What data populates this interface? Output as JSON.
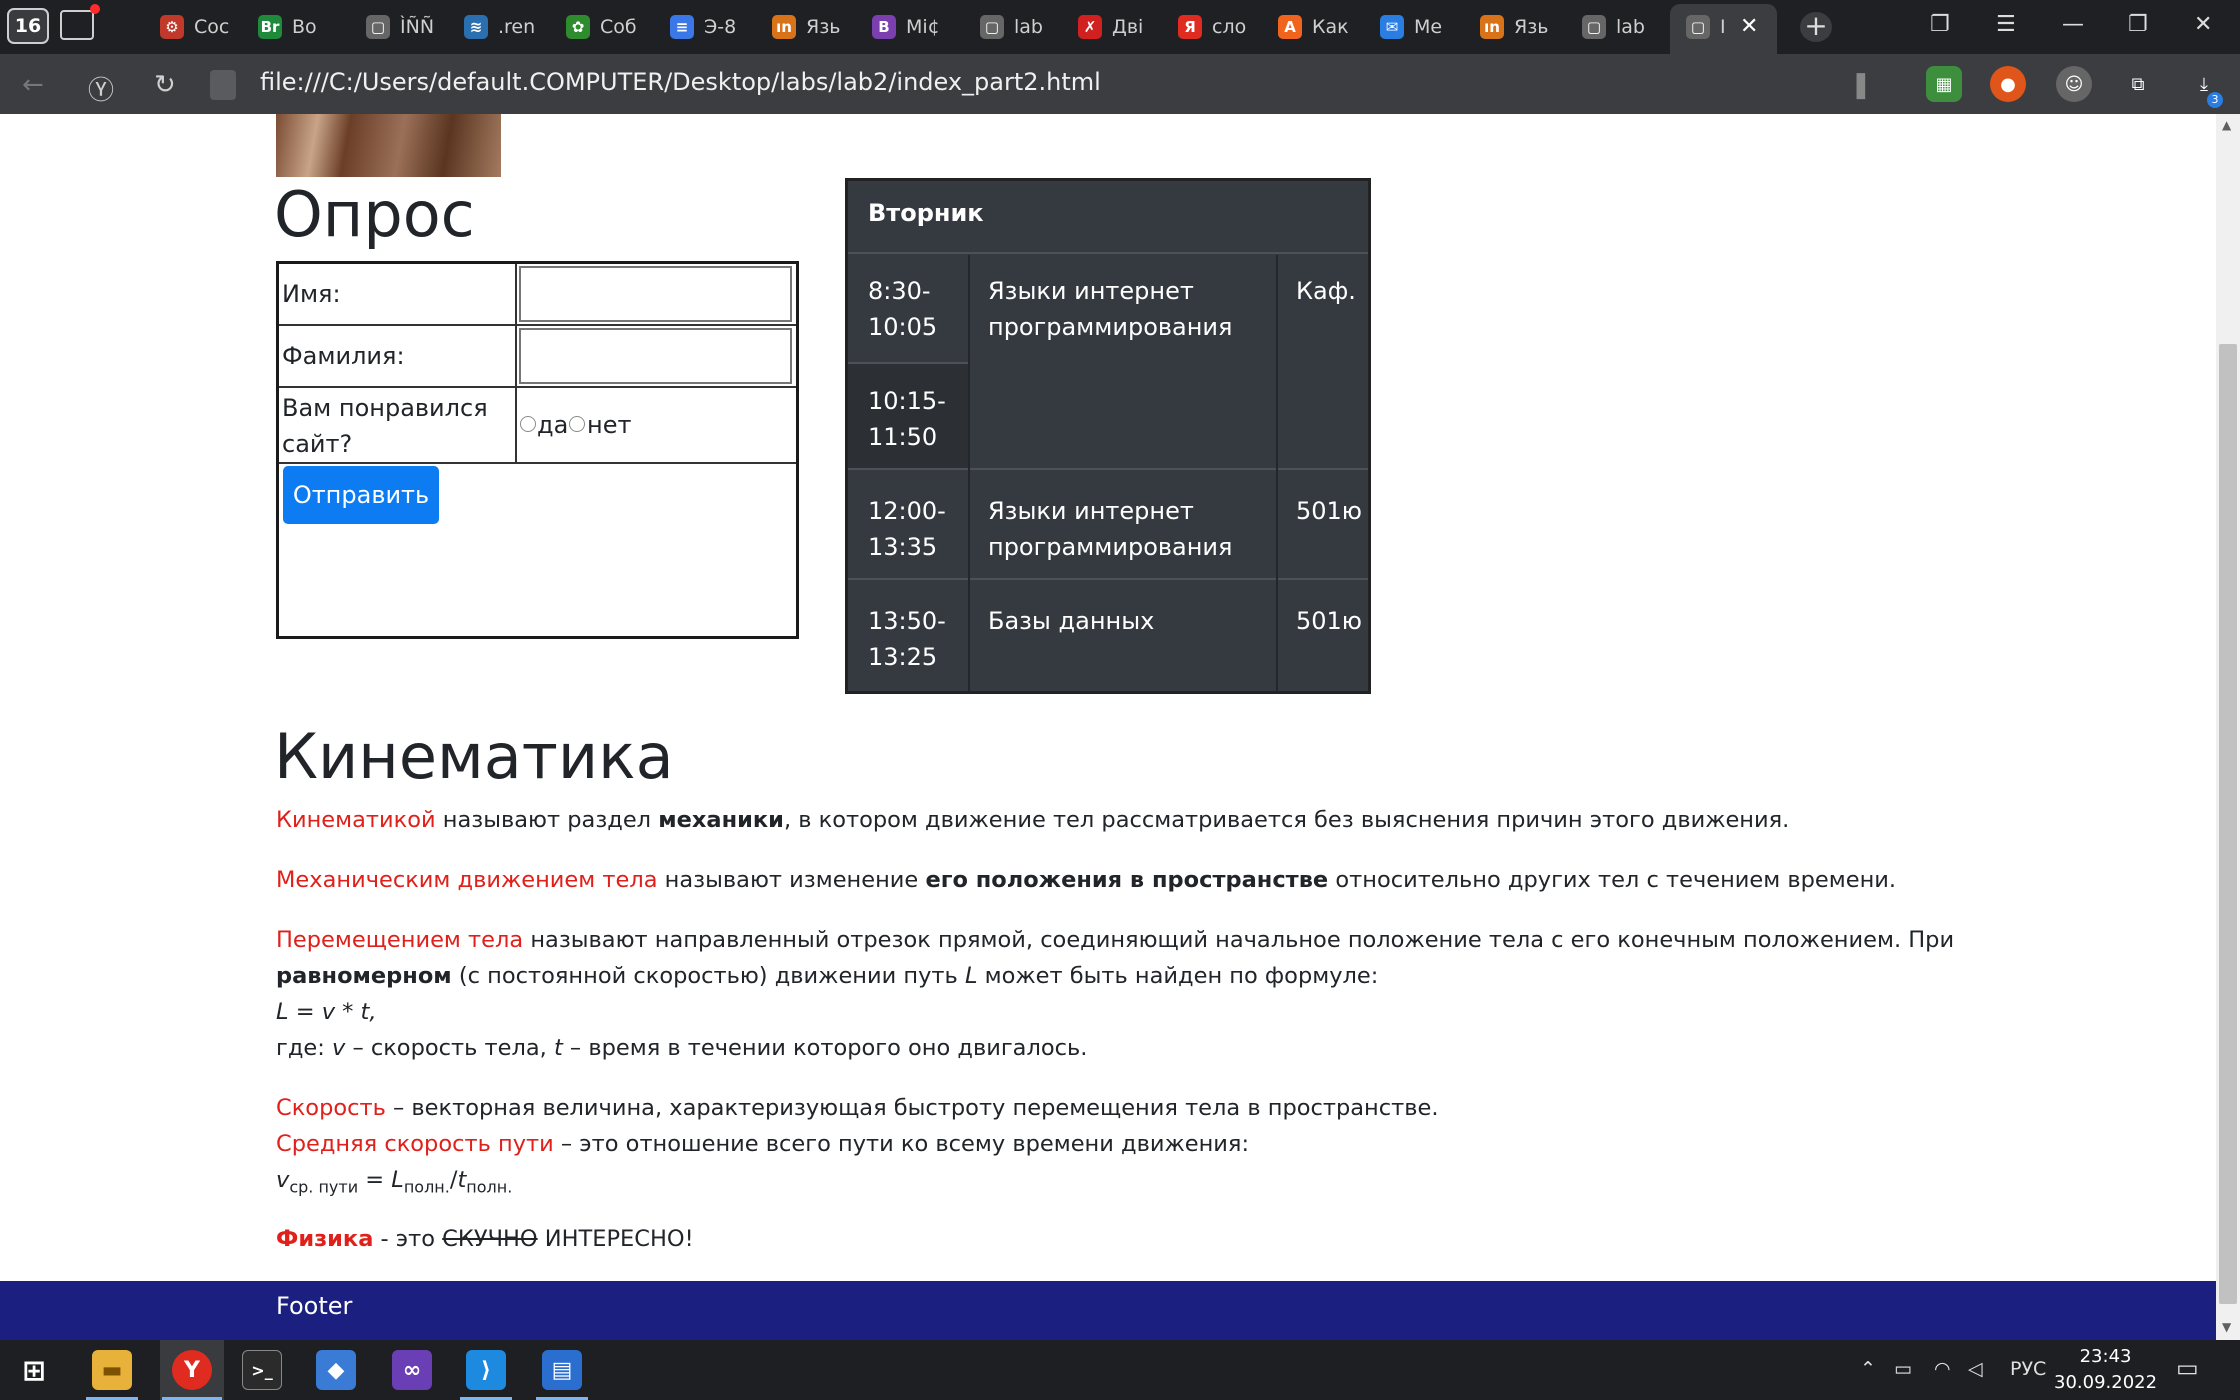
{
  "browser": {
    "tab_count": "16",
    "tabs": [
      {
        "label": "Coc",
        "fav": "⚙",
        "color": "#c0392b"
      },
      {
        "label": "Bo",
        "fav": "Br",
        "color": "#1f8a3b"
      },
      {
        "label": "ÌÑÑ",
        "fav": "▢",
        "color": "#666666"
      },
      {
        "label": ".ren",
        "fav": "≋",
        "color": "#2a6fb0"
      },
      {
        "label": "Coб",
        "fav": "✿",
        "color": "#2e8b2e"
      },
      {
        "label": "Э-8",
        "fav": "≡",
        "color": "#3b78e7"
      },
      {
        "label": "Язь",
        "fav": "ın",
        "color": "#d9731a"
      },
      {
        "label": "Mi¢",
        "fav": "B",
        "color": "#7b3fb0"
      },
      {
        "label": "lab",
        "fav": "▢",
        "color": "#666666"
      },
      {
        "label": "Дві",
        "fav": "✗",
        "color": "#d02020"
      },
      {
        "label": "сло",
        "fav": "Я",
        "color": "#e02b20"
      },
      {
        "label": "Как",
        "fav": "A",
        "color": "#f0641e"
      },
      {
        "label": "Ме",
        "fav": "✉",
        "color": "#2a7de1"
      },
      {
        "label": "Язь",
        "fav": "ın",
        "color": "#d9731a"
      },
      {
        "label": "lab",
        "fav": "▢",
        "color": "#666666"
      },
      {
        "label": "I",
        "fav": "▢",
        "color": "#666666"
      }
    ],
    "new_tab_symbol": "+",
    "url": "file:///C:/Users/default.COMPUTER/Desktop/labs/lab2/index_part2.html",
    "downloads_badge": "3"
  },
  "survey": {
    "heading": "Опрос",
    "name_label": "Имя:",
    "surname_label": "Фамилия:",
    "liked_label_line1": "Вам понравился",
    "liked_label_line2": "сайт?",
    "yes_label": "да",
    "no_label": "нет",
    "submit_label": "Отправить"
  },
  "schedule": {
    "day": "Вторник",
    "rows": [
      {
        "time1": "8:30-",
        "time2": "10:05"
      },
      {
        "time1": "10:15-",
        "time2": "11:50"
      },
      {
        "time1": "12:00-",
        "time2": "13:35"
      },
      {
        "time1": "13:50-",
        "time2": "13:25"
      }
    ],
    "subject_a_1": "Языки интернет",
    "subject_a_2": "программирования",
    "room_a": "Каф.",
    "subject_b_1": "Языки интернет",
    "subject_b_2": "программирования",
    "room_b": "501ю",
    "subject_c": "Базы данных",
    "room_c": "501ю"
  },
  "kinematics": {
    "heading": "Кинематика",
    "p1_red": "Кинематикой",
    "p1_a": " называют раздел ",
    "p1_bold": "механики",
    "p1_b": ", в котором движение тел рассматривается без выяснения причин этого движения.",
    "p2_red": "Механическим движением тела",
    "p2_a": " называют изменение ",
    "p2_bold": "его положения в пространстве",
    "p2_b": " относительно других тел с течением времени.",
    "p3_red": "Перемещением тела",
    "p3_a": " называют направленный отрезок прямой, соединяющий начальное положение тела с его конечным положением. При",
    "p3_bold": "равномерном",
    "p3_b": " (с постоянной скоростью) движении путь ",
    "p3_L": "L",
    "p3_c": " может быть найден по формуле:",
    "formula": "L = v * t,",
    "where_a": "где: ",
    "where_v": "v",
    "where_b": " – скорость тела, ",
    "where_t": "t",
    "where_c": " – время в течении которого оно двигалось.",
    "p4_red": "Скорость",
    "p4_a": " – векторная величина, характеризующая быстроту перемещения тела в пространстве.",
    "p5_red": "Средняя скорость пути",
    "p5_a": " – это отношение всего пути ко всему времени движения:",
    "f2_v": "v",
    "f2_vsub": "ср. пути",
    "f2_eq": " = ",
    "f2_L": "L",
    "f2_Lsub": "полн.",
    "f2_slash": "/",
    "f2_t": "t",
    "f2_tsub": "полн.",
    "p6_red": "Физика",
    "p6_a": " - это ",
    "p6_strike": "СКУЧНО",
    "p6_b": " ИНТЕРЕСНО!"
  },
  "footer": {
    "label": "Footer"
  },
  "taskbar": {
    "lang": "РУС",
    "time": "23:43",
    "date": "30.09.2022"
  }
}
